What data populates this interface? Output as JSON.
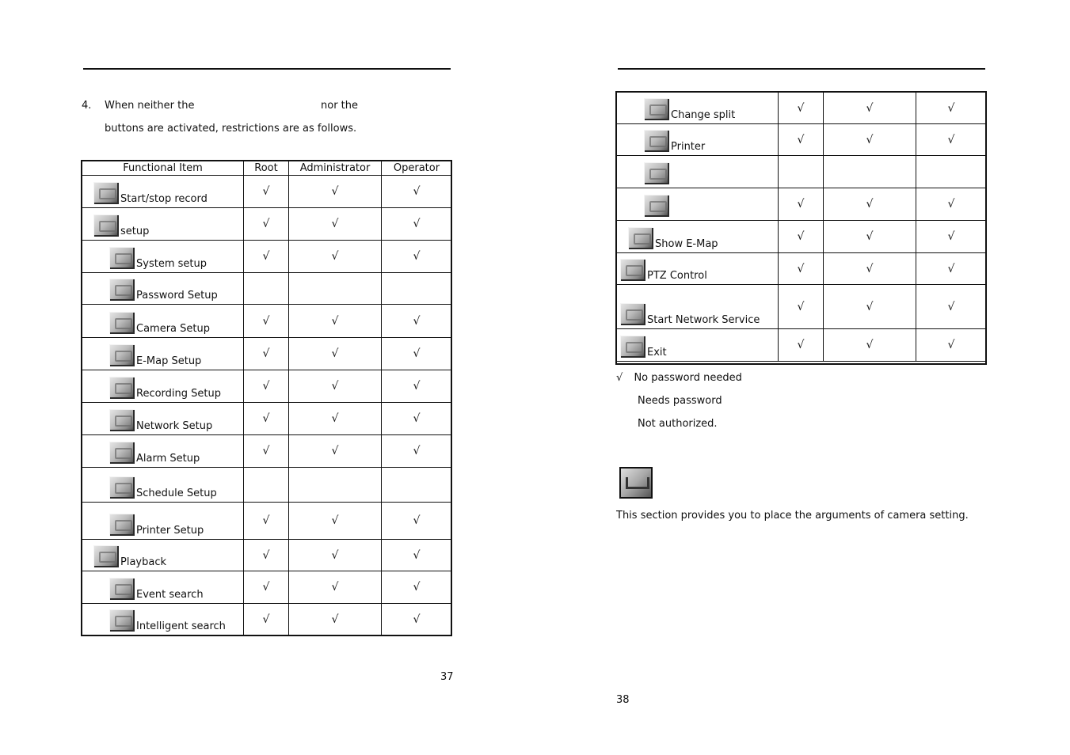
{
  "left_page": {
    "intro_line1": {
      "number": "4.",
      "text_a": "When neither the",
      "text_b": "nor the"
    },
    "intro_line2": "buttons are activated, restrictions are as follows.",
    "table": {
      "headers": [
        "Functional Item",
        "Root",
        "Administrator",
        "Operator"
      ],
      "rows": [
        {
          "label": "Start/stop record",
          "icon": "record-icon",
          "indent": 1,
          "root": "√",
          "admin": "√",
          "operator": "√"
        },
        {
          "label": "setup",
          "icon": "setup-icon",
          "indent": 1,
          "root": "√",
          "admin": "√",
          "operator": "√"
        },
        {
          "label": "System setup",
          "icon": "system-setup-icon",
          "indent": 2,
          "root": "√",
          "admin": "√",
          "operator": "√"
        },
        {
          "label": "Password Setup",
          "icon": "password-setup-icon",
          "indent": 2,
          "root": "",
          "admin": "",
          "operator": ""
        },
        {
          "label": "Camera Setup",
          "icon": "camera-setup-icon",
          "indent": 2,
          "root": "√",
          "admin": "√",
          "operator": "√"
        },
        {
          "label": "E-Map Setup",
          "icon": "emap-setup-icon",
          "indent": 2,
          "root": "√",
          "admin": "√",
          "operator": "√"
        },
        {
          "label": "Recording Setup",
          "icon": "recording-setup-icon",
          "indent": 2,
          "root": "√",
          "admin": "√",
          "operator": "√"
        },
        {
          "label": "Network Setup",
          "icon": "network-setup-icon",
          "indent": 2,
          "root": "√",
          "admin": "√",
          "operator": "√"
        },
        {
          "label": "Alarm Setup",
          "icon": "alarm-setup-icon",
          "indent": 2,
          "root": "√",
          "admin": "√",
          "operator": "√"
        },
        {
          "label": "Schedule Setup",
          "icon": "schedule-setup-icon",
          "indent": 2,
          "root": "",
          "admin": "",
          "operator": ""
        },
        {
          "label": "Printer Setup",
          "icon": "printer-setup-icon",
          "indent": 2,
          "root": "√",
          "admin": "√",
          "operator": "√"
        },
        {
          "label": "Playback",
          "icon": "playback-icon",
          "indent": 1,
          "root": "√",
          "admin": "√",
          "operator": "√"
        },
        {
          "label": "Event search",
          "icon": "event-search-icon",
          "indent": 2,
          "root": "√",
          "admin": "√",
          "operator": "√"
        },
        {
          "label": "Intelligent search",
          "icon": "intelligent-search-icon",
          "indent": 2,
          "root": "√",
          "admin": "√",
          "operator": "√"
        }
      ]
    },
    "page_number": "37"
  },
  "right_page": {
    "table": {
      "rows": [
        {
          "label": "Change split",
          "icon": "change-split-icon",
          "indent": 2,
          "root": "√",
          "admin": "√",
          "operator": "√"
        },
        {
          "label": "Printer",
          "icon": "printer-icon",
          "indent": 2,
          "root": "√",
          "admin": "√",
          "operator": "√"
        },
        {
          "label": "",
          "icon": "snapshot-icon",
          "indent": 2,
          "root": "",
          "admin": "",
          "operator": ""
        },
        {
          "label": "",
          "icon": "backup-icon",
          "indent": 2,
          "root": "√",
          "admin": "√",
          "operator": "√"
        },
        {
          "label": "Show E-Map",
          "icon": "show-emap-icon",
          "indent": 1,
          "root": "√",
          "admin": "√",
          "operator": "√"
        },
        {
          "label": "PTZ Control",
          "icon": "ptz-control-icon",
          "indent": 0,
          "root": "√",
          "admin": "√",
          "operator": "√"
        },
        {
          "label": "Start Network Service",
          "icon": "network-service-icon",
          "indent": 0,
          "root": "√",
          "admin": "√",
          "operator": "√"
        },
        {
          "label": "Exit",
          "icon": "exit-icon",
          "indent": 0,
          "root": "√",
          "admin": "√",
          "operator": "√"
        }
      ]
    },
    "legend": [
      {
        "symbol": "√",
        "text": "No password needed"
      },
      {
        "symbol": "",
        "text": "Needs password"
      },
      {
        "symbol": "",
        "text": "Not authorized."
      }
    ],
    "section_icon": "camera-setup-icon",
    "section_text": "This section provides you to place the arguments of camera setting.",
    "page_number": "38"
  }
}
